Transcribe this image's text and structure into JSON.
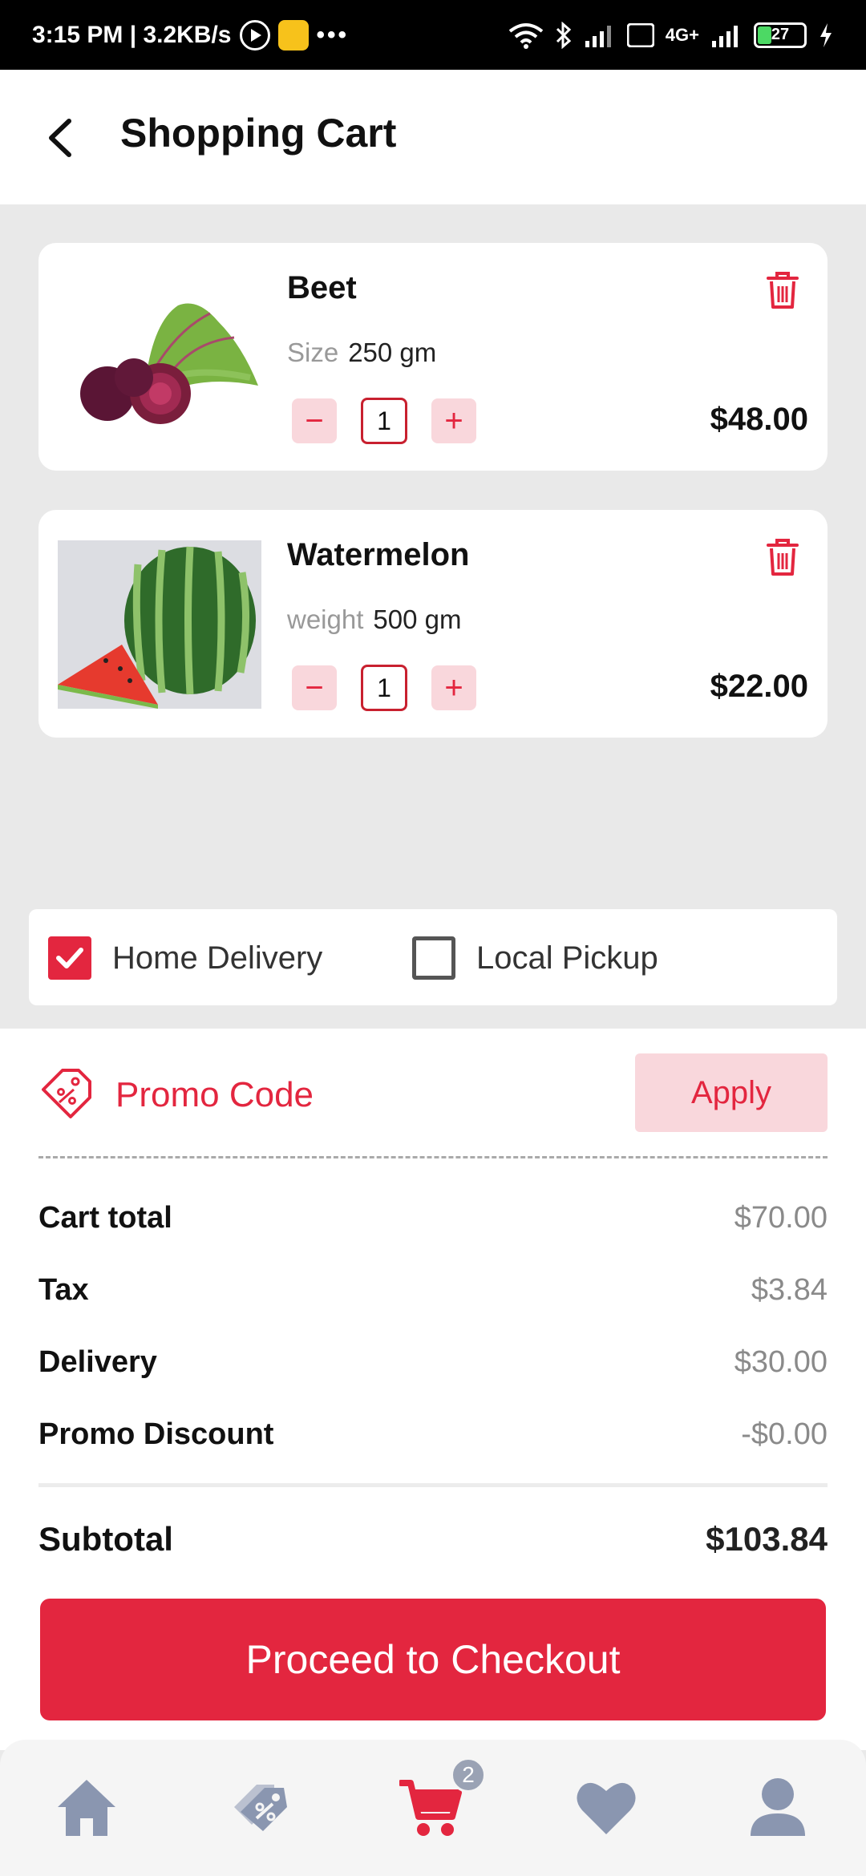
{
  "status_bar": {
    "time_speed": "3:15 PM | 3.2KB/s",
    "dots": "•••",
    "signal_label": "4G+",
    "battery": "27"
  },
  "header": {
    "title": "Shopping Cart"
  },
  "cart": {
    "items": [
      {
        "name": "Beet",
        "attr_label": "Size",
        "attr_value": "250 gm",
        "qty": "1",
        "price": "$48.00"
      },
      {
        "name": "Watermelon",
        "attr_label": "weight",
        "attr_value": "500 gm",
        "qty": "1",
        "price": "$22.00"
      }
    ],
    "minus_symbol": "−",
    "plus_symbol": "+"
  },
  "delivery": {
    "home_label": "Home Delivery",
    "home_checked": true,
    "pickup_label": "Local Pickup",
    "pickup_checked": false
  },
  "promo": {
    "label": "Promo Code",
    "apply_label": "Apply"
  },
  "summary": {
    "rows": [
      {
        "label": "Cart total",
        "value": "$70.00"
      },
      {
        "label": "Tax",
        "value": "$3.84"
      },
      {
        "label": "Delivery",
        "value": "$30.00"
      },
      {
        "label": "Promo Discount",
        "value": "-$0.00"
      }
    ],
    "subtotal_label": "Subtotal",
    "subtotal_value": "$103.84",
    "checkout_label": "Proceed to Checkout"
  },
  "nav": {
    "items": [
      "home-icon",
      "offers-icon",
      "cart-icon",
      "heart-icon",
      "profile-icon"
    ],
    "cart_badge": "2"
  },
  "colors": {
    "accent": "#e3263f",
    "accent_light": "#f9d7dc",
    "nav_inactive": "#8a96b0"
  }
}
